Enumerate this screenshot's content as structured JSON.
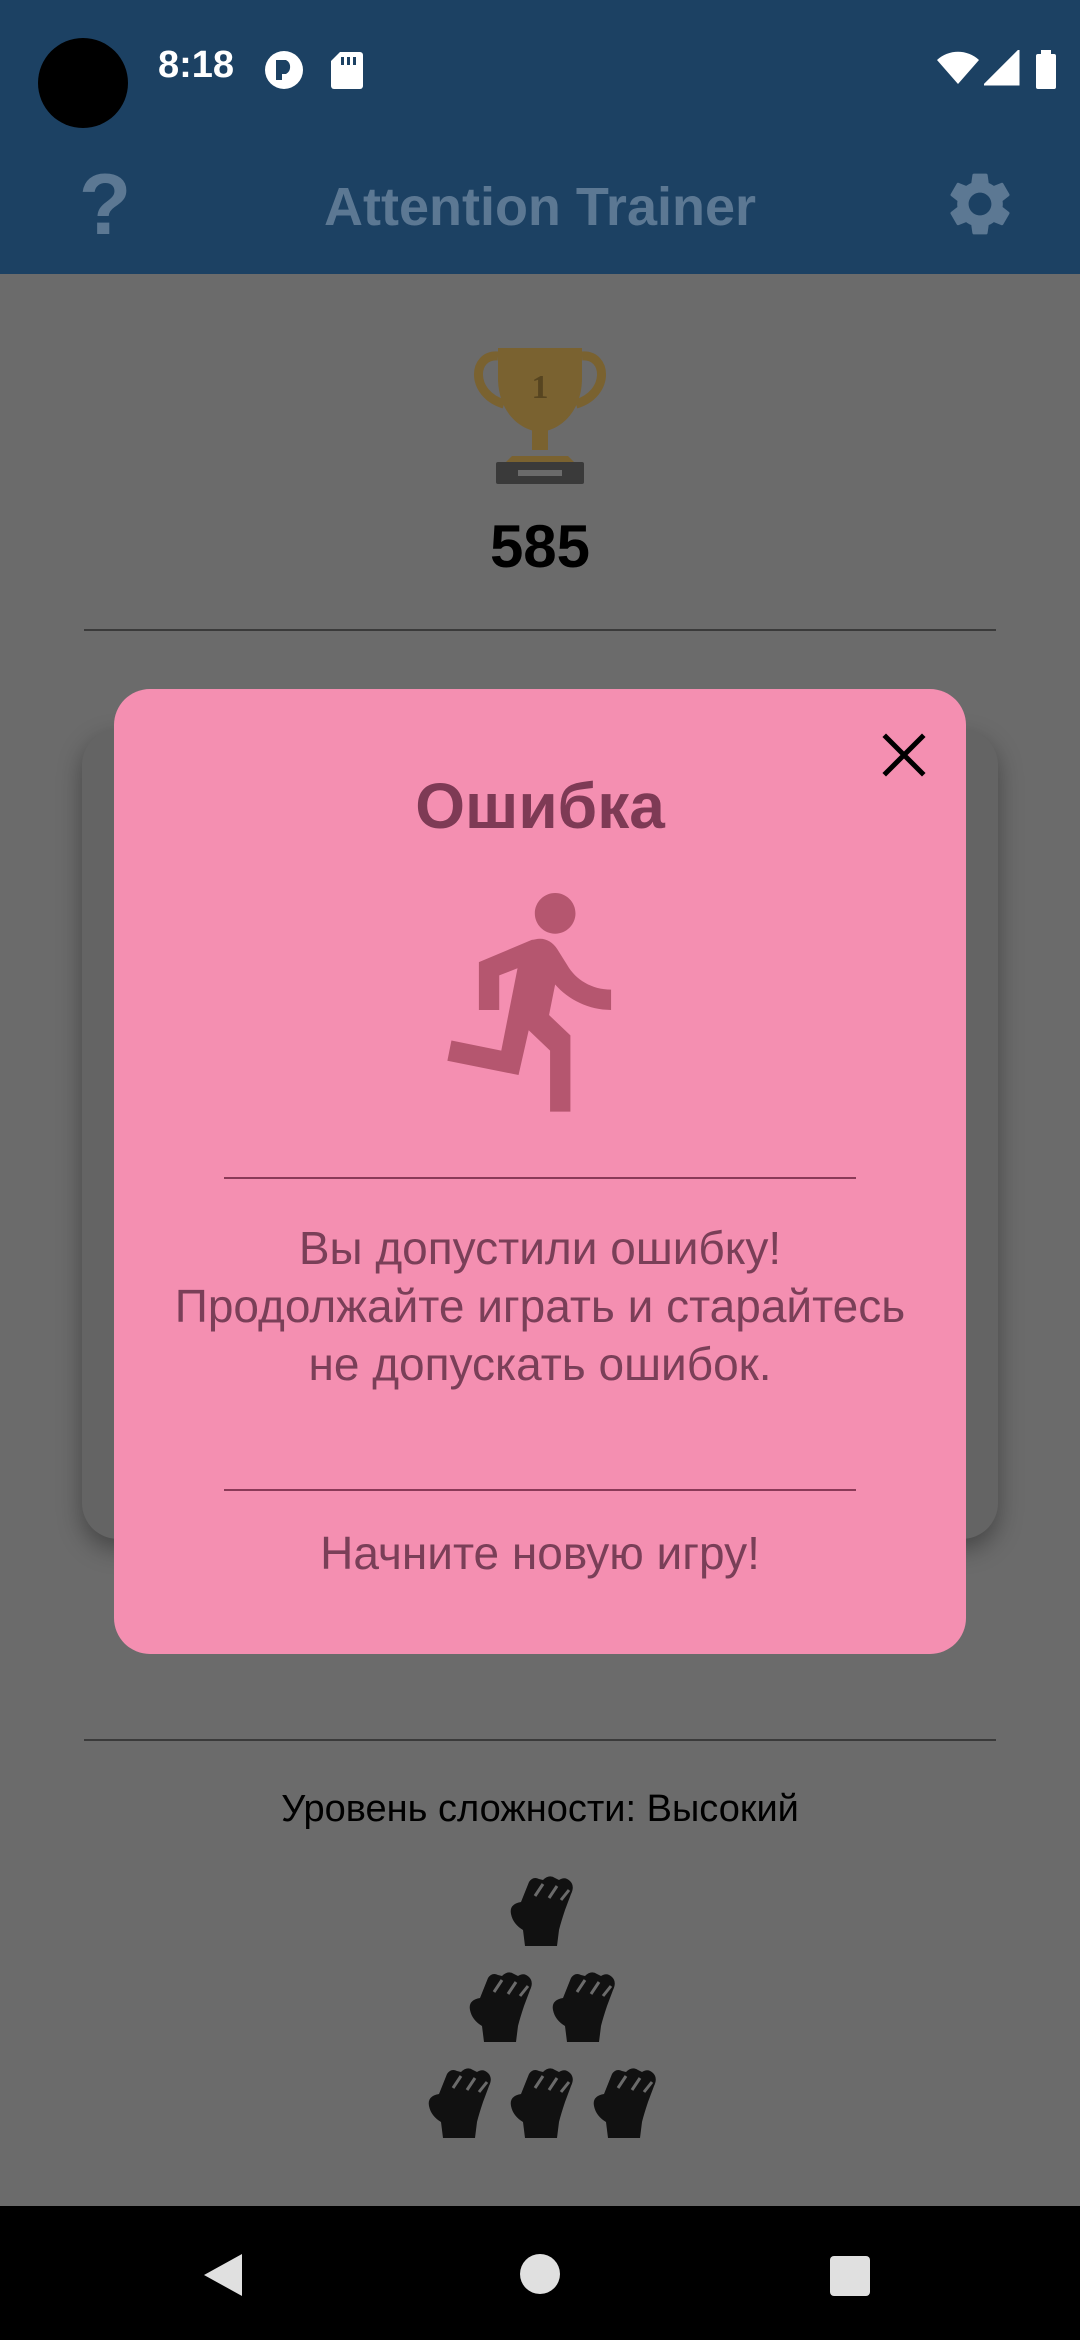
{
  "status_bar": {
    "time": "8:18"
  },
  "app_bar": {
    "title": "Attention Trainer",
    "help_label": "?"
  },
  "trophy": {
    "rank_label": "1"
  },
  "best_score": "585",
  "difficulty_text": "Уровень сложности: Высокий",
  "difficulty_level_fists": 6,
  "dialog": {
    "title": "Ошибка",
    "message": "Вы допустили ошибку! Продолжайте играть и старайтесь не допускать ошибок.",
    "footer": "Начните новую игру!"
  },
  "colors": {
    "app_bar": "#1c4163",
    "dialog_background": "#f48fb1",
    "dialog_text": "#7a3f58",
    "dim_overlay": "#6b6b6b"
  }
}
